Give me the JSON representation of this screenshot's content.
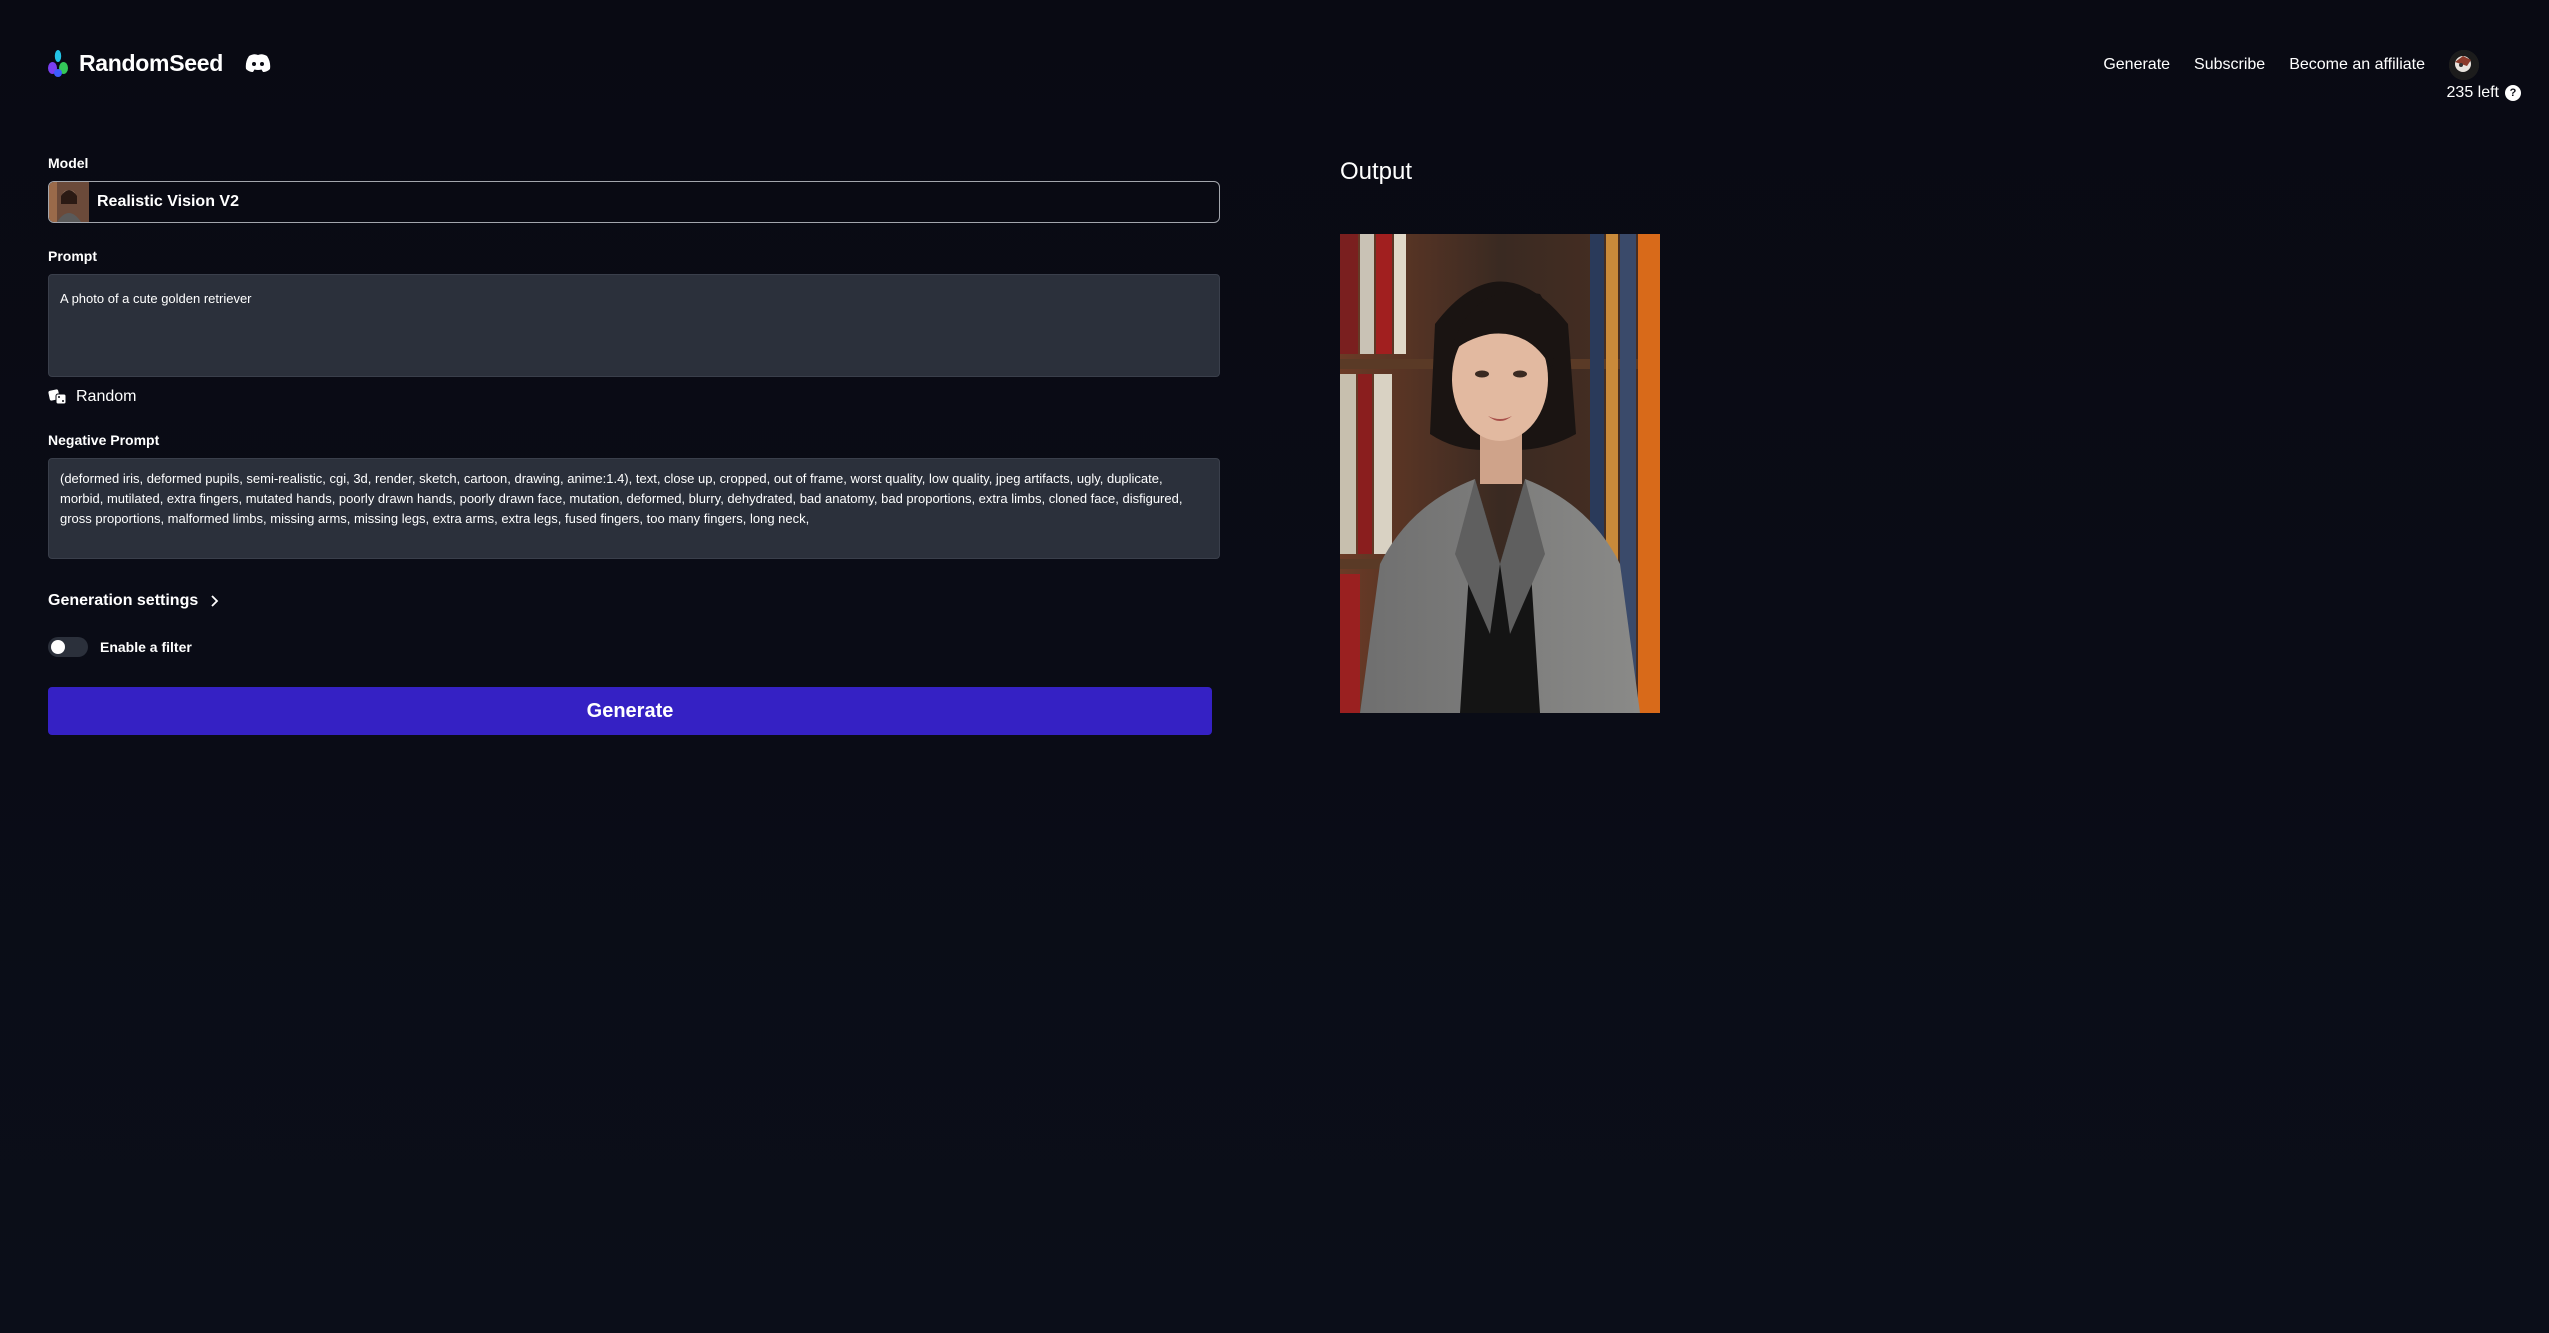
{
  "header": {
    "brand": "RandomSeed",
    "nav": [
      "Generate",
      "Subscribe",
      "Become an affiliate"
    ],
    "credits": "235 left",
    "help_glyph": "?"
  },
  "form": {
    "model_label": "Model",
    "model_value": "Realistic Vision V2",
    "prompt_label": "Prompt",
    "prompt_value": "A photo of a cute golden retriever",
    "random_label": "Random",
    "negative_label": "Negative Prompt",
    "negative_value": "(deformed iris, deformed pupils, semi-realistic, cgi, 3d, render, sketch, cartoon, drawing, anime:1.4), text, close up, cropped, out of frame, worst quality, low quality, jpeg artifacts, ugly, duplicate, morbid, mutilated, extra fingers, mutated hands, poorly drawn hands, poorly drawn face, mutation, deformed, blurry, dehydrated, bad anatomy, bad proportions, extra limbs, cloned face, disfigured, gross proportions, malformed limbs, missing arms, missing legs, extra arms, extra legs, fused fingers, too many fingers, long neck,",
    "generation_settings_label": "Generation settings",
    "filter_label": "Enable a filter",
    "filter_enabled": false,
    "generate_label": "Generate"
  },
  "output": {
    "title": "Output",
    "image_icon": "portrait-image"
  },
  "colors": {
    "background": "#0a0b14",
    "accent": "#3521c4",
    "input_bg": "#2b303b"
  }
}
